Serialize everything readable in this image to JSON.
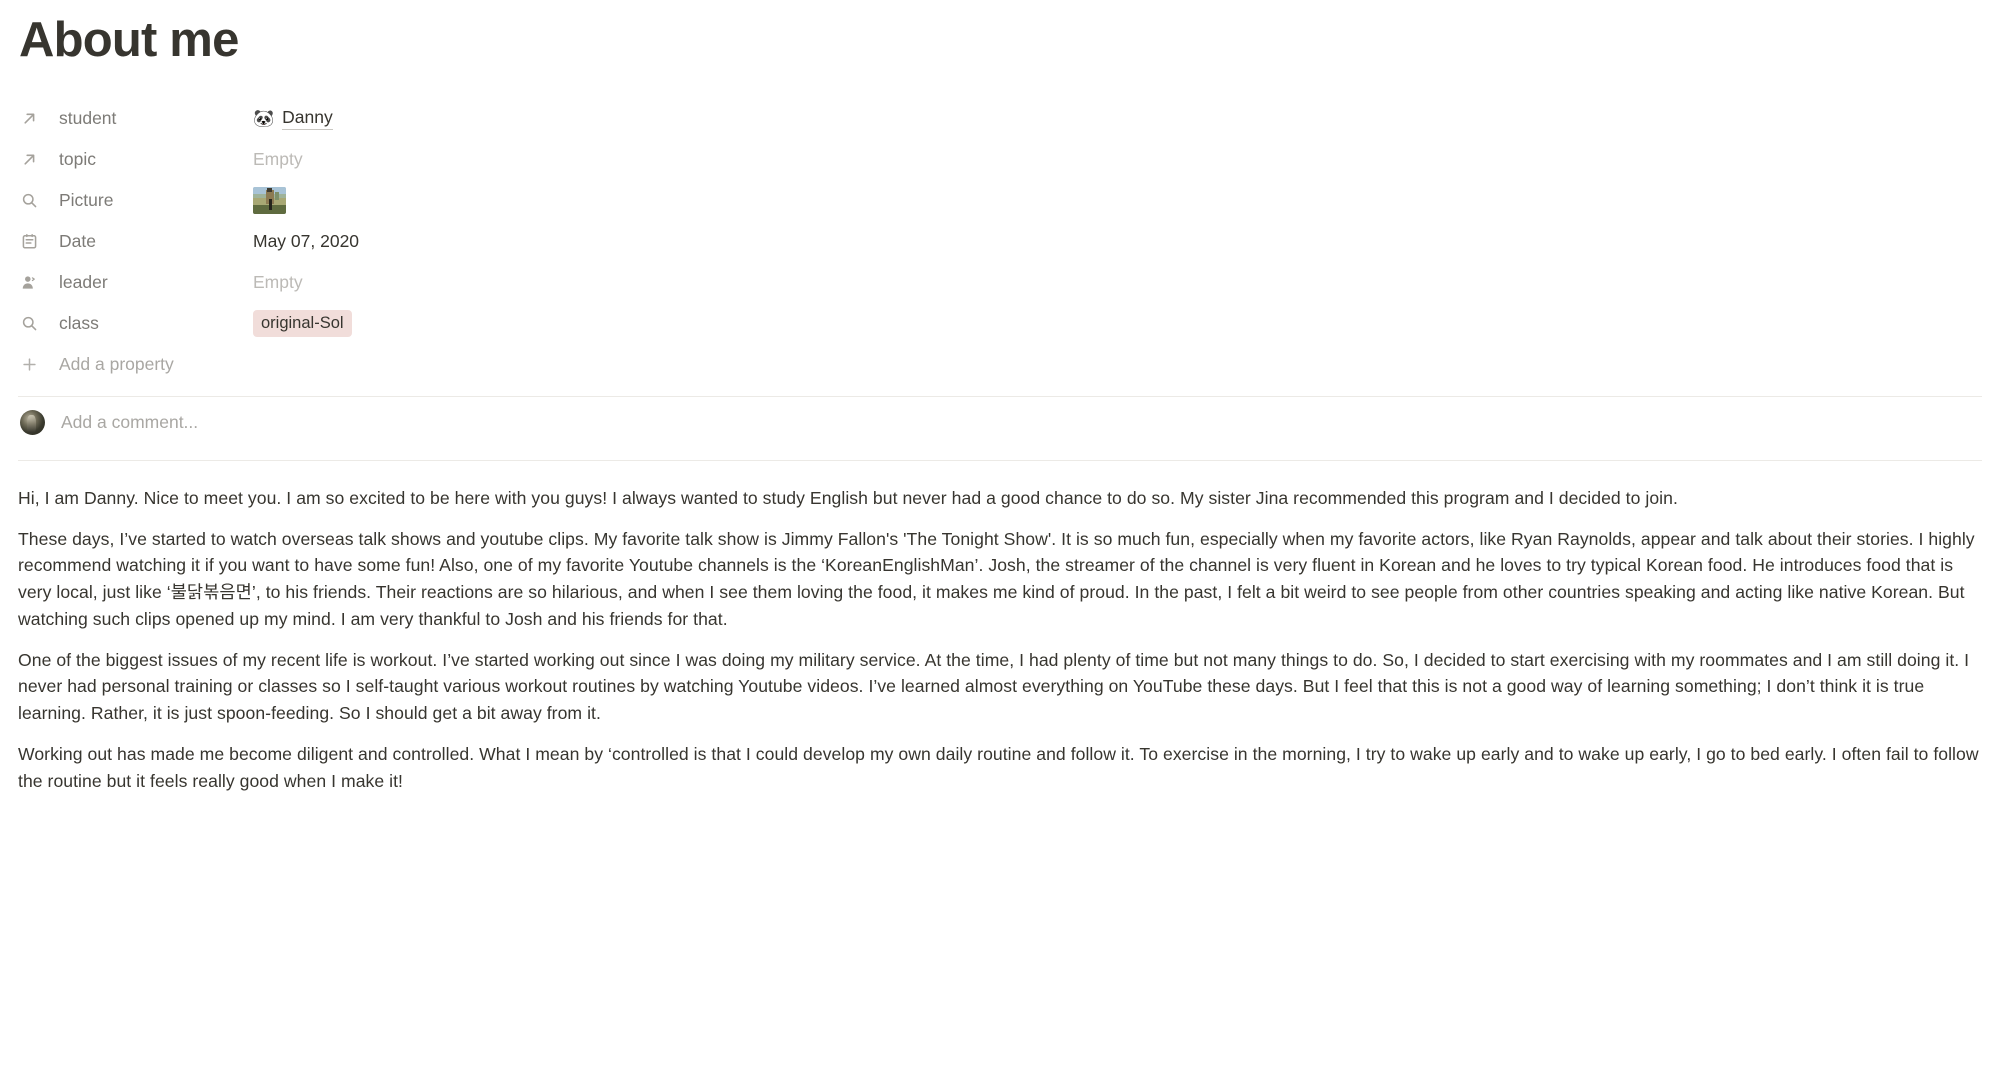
{
  "page": {
    "title": "About me"
  },
  "properties": [
    {
      "icon": "relation-arrow-icon",
      "name": "student",
      "type": "relation",
      "emoji": "🐼",
      "value": "Danny",
      "empty": false
    },
    {
      "icon": "relation-arrow-icon",
      "name": "topic",
      "type": "relation",
      "value": "Empty",
      "empty": true
    },
    {
      "icon": "search-icon",
      "name": "Picture",
      "type": "image",
      "value": "",
      "empty": false
    },
    {
      "icon": "calendar-icon",
      "name": "Date",
      "type": "date",
      "value": "May 07, 2020",
      "empty": false
    },
    {
      "icon": "person-icon",
      "name": "leader",
      "type": "person",
      "value": "Empty",
      "empty": true
    },
    {
      "icon": "search-icon",
      "name": "class",
      "type": "tag",
      "value": "original-Sol",
      "empty": false
    }
  ],
  "add_property": {
    "icon": "plus-icon",
    "label": "Add a property"
  },
  "comment": {
    "placeholder": "Add a comment...",
    "avatar": "user-avatar"
  },
  "body": {
    "paragraphs": [
      "Hi, I am Danny. Nice to meet you. I am so excited to be here with you guys! I always wanted to study English but never had a good chance to do so. My sister Jina recommended this program and I decided to join.",
      "These days, I’ve started to watch overseas talk shows and youtube clips. My favorite talk show is Jimmy Fallon's 'The Tonight Show'. It is so much fun, especially when my favorite actors, like Ryan Raynolds, appear and talk about their stories. I highly recommend watching it if you want to have some fun! Also, one of my favorite Youtube channels is the ‘KoreanEnglishMan’. Josh, the streamer of the channel is very fluent in Korean and he loves to try typical Korean food. He introduces food that is very local, just like ‘불닭볶음면’, to his friends. Their reactions are so hilarious, and when I see them loving the food, it makes me kind of proud. In the past, I felt a bit weird to see people from other countries speaking and acting like native Korean. But watching such clips opened up my mind. I am very thankful to Josh and his friends for that.",
      "One of the biggest issues of my recent life is workout. I’ve started working out since I was doing my military service. At the time, I had plenty of time but not many things to do. So, I decided to start exercising with my roommates and I am still doing it. I never had personal training or classes so I self-taught various workout routines by watching Youtube videos. I’ve learned almost everything on YouTube these days. But I feel that this is not a good way of learning something; I don’t think it is true learning. Rather, it is just spoon-feeding. So I should get a bit away from it.",
      "Working out has made me become diligent and controlled. What I mean by ‘controlled is that I could develop my own daily routine and follow it. To exercise in the morning, I try to wake up early and to wake up early, I go to bed early. I often fail to follow the routine but it feels really good when I make it!"
    ]
  },
  "colors": {
    "text": "#37352f",
    "muted": "#9b9a97",
    "placeholder": "#a9a7a3",
    "tag_background": "#f1ddda",
    "divider": "#eceae6"
  }
}
